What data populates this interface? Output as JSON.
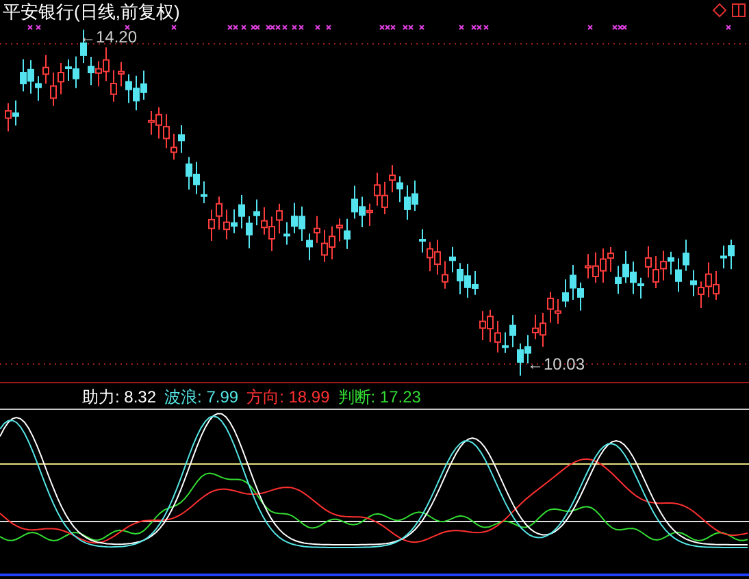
{
  "main_chart": {
    "title": "平安银行(日线,前复权)",
    "high_label": "←14.20",
    "low_label": "←10.03"
  },
  "indicator": {
    "readings": [
      {
        "label": "助力:",
        "value": "8.32",
        "color": "#ffffff"
      },
      {
        "label": "波浪:",
        "value": "7.99",
        "color": "#55e6e6"
      },
      {
        "label": "方向:",
        "value": "18.99",
        "color": "#ff3030"
      },
      {
        "label": "判断:",
        "value": "17.23",
        "color": "#33dd33"
      }
    ]
  }
}
